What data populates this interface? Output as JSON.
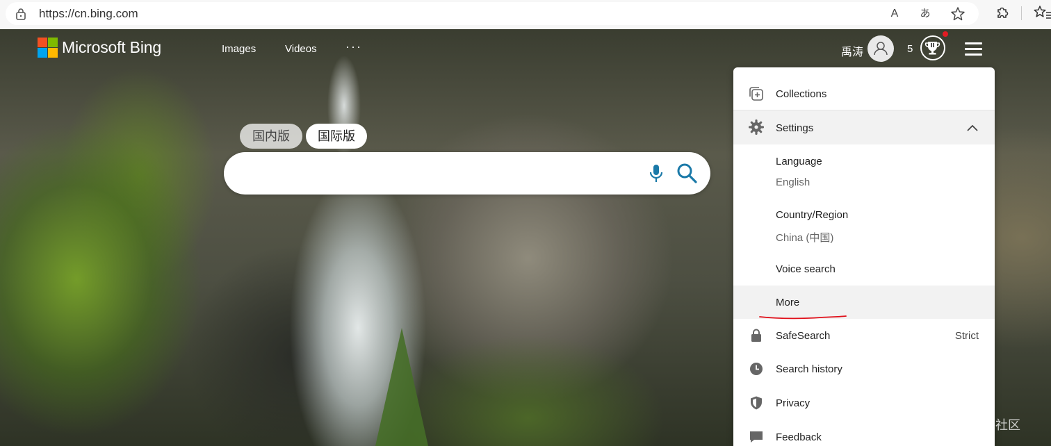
{
  "browser": {
    "url": "https://cn.bing.com",
    "icons": [
      "lock-icon",
      "read-aloud-icon",
      "translate-icon",
      "favorite-star-icon",
      "extensions-icon",
      "favorites-icon"
    ],
    "read_aloud_glyph": "A",
    "translate_glyph": "あ"
  },
  "header": {
    "brand": "Microsoft Bing",
    "nav": [
      "Images",
      "Videos"
    ],
    "more_glyph": "···",
    "username": "禹涛",
    "points": "5"
  },
  "search": {
    "tabs": [
      "国内版",
      "国际版"
    ],
    "active_tab": "国际版",
    "value": "",
    "placeholder": ""
  },
  "menu": {
    "collections": "Collections",
    "settings": "Settings",
    "language_label": "Language",
    "language_value": "English",
    "region_label": "Country/Region",
    "region_value": "China (中国)",
    "voice_search": "Voice search",
    "more": "More",
    "safesearch_label": "SafeSearch",
    "safesearch_value": "Strict",
    "search_history": "Search history",
    "privacy": "Privacy",
    "feedback": "Feedback"
  },
  "watermark": "@稀土掘金技术社区",
  "colors": {
    "accent": "#1a79a8",
    "menu_hover": "#f2f2f2",
    "annotation_red": "#e0101a",
    "notification_dot": "#e31b23"
  }
}
